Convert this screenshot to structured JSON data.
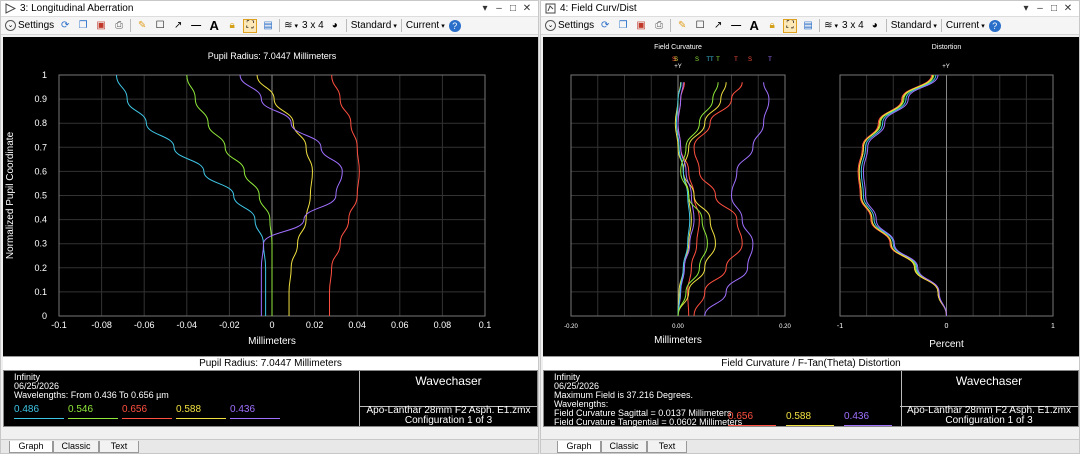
{
  "windows": {
    "left": {
      "title": "3: Longitudinal Aberration",
      "toolbar": {
        "settings": "Settings",
        "layout": "3 x 4",
        "standard": "Standard",
        "current": "Current"
      },
      "plot_title": "Pupil Radius: 7.0447 Millimeters",
      "panel_title": "Pupil Radius: 7.0447 Millimeters",
      "info": {
        "line1": "Infinity",
        "line2": "06/25/2026",
        "line3": "Wavelengths: From 0.436 To 0.656 µm",
        "brand": "Wavechaser",
        "lens": "Apo-Lanthar 28mm F2 Asph. E1.zmx",
        "config": "Configuration 1 of 3",
        "wavelengths": [
          "0.486",
          "0.546",
          "0.656",
          "0.588",
          "0.436"
        ]
      },
      "tabs": [
        "Graph",
        "Classic",
        "Text"
      ]
    },
    "right": {
      "title": "4: Field Curv/Dist",
      "toolbar": {
        "settings": "Settings",
        "layout": "3 x 4",
        "standard": "Standard",
        "current": "Current"
      },
      "panel_title": "Field Curvature / F-Tan(Theta) Distortion",
      "info": {
        "line1": "Infinity",
        "line2": "06/25/2026",
        "line3": "Maximum Field is 37.216 Degrees.",
        "line4": "Wavelengths:",
        "line5": "Field Curvature Sagittal = 0.0137 Millimeters",
        "line6": "Field Curvature Tangential = 0.0602 Millimeters",
        "brand": "Wavechaser",
        "lens": "Apo-Lanthar 28mm F2 Asph. E1.zmx",
        "config": "Configuration 1 of 3",
        "wavelengths": [
          "0.656",
          "0.588",
          "0.436"
        ]
      },
      "tabs": [
        "Graph",
        "Classic",
        "Text"
      ]
    }
  },
  "colors": {
    "w486": "#3fc6e6",
    "w546": "#8fe83a",
    "w656": "#ff5040",
    "w588": "#f0e040",
    "w436": "#a070ff"
  },
  "chart_data": [
    {
      "type": "line",
      "title": "Pupil Radius: 7.0447 Millimeters",
      "xlabel": "Millimeters",
      "ylabel": "Normalized Pupil Coordinate",
      "xlim": [
        -0.1,
        0.1
      ],
      "ylim": [
        0,
        1
      ],
      "xticks": [
        "-0.1",
        "-0.08",
        "-0.06",
        "-0.04",
        "-0.02",
        "0",
        "0.02",
        "0.04",
        "0.06",
        "0.08",
        "0.1"
      ],
      "yticks": [
        "0",
        "0.1",
        "0.2",
        "0.3",
        "0.4",
        "0.5",
        "0.6",
        "0.7",
        "0.8",
        "0.9",
        "1"
      ],
      "grid": true,
      "series": [
        {
          "name": "0.486",
          "color": "#3fc6e6",
          "x": [
            -0.003,
            -0.003,
            -0.003,
            -0.004,
            -0.008,
            -0.018,
            -0.032,
            -0.046,
            -0.059,
            -0.068,
            -0.073
          ],
          "y": [
            0,
            0.1,
            0.2,
            0.3,
            0.4,
            0.5,
            0.6,
            0.7,
            0.8,
            0.9,
            1.0
          ]
        },
        {
          "name": "0.546",
          "color": "#8fe83a",
          "x": [
            0.0,
            0.0,
            0.0,
            0.0,
            -0.001,
            -0.006,
            -0.013,
            -0.022,
            -0.03,
            -0.036,
            -0.04
          ],
          "y": [
            0,
            0.1,
            0.2,
            0.3,
            0.4,
            0.5,
            0.6,
            0.7,
            0.8,
            0.9,
            1.0
          ]
        },
        {
          "name": "0.656",
          "color": "#ff5040",
          "x": [
            0.027,
            0.027,
            0.028,
            0.032,
            0.036,
            0.04,
            0.041,
            0.04,
            0.037,
            0.032,
            0.028
          ],
          "y": [
            0,
            0.1,
            0.2,
            0.3,
            0.4,
            0.5,
            0.6,
            0.7,
            0.8,
            0.9,
            1.0
          ]
        },
        {
          "name": "0.588",
          "color": "#f0e040",
          "x": [
            0.008,
            0.008,
            0.009,
            0.012,
            0.016,
            0.018,
            0.019,
            0.016,
            0.01,
            0.001,
            -0.007
          ],
          "y": [
            0,
            0.1,
            0.2,
            0.3,
            0.4,
            0.5,
            0.6,
            0.7,
            0.8,
            0.9,
            1.0
          ]
        },
        {
          "name": "0.436",
          "color": "#a070ff",
          "x": [
            -0.005,
            -0.005,
            -0.005,
            -0.004,
            0.015,
            0.03,
            0.033,
            0.023,
            0.009,
            -0.005,
            -0.015
          ],
          "y": [
            0,
            0.1,
            0.2,
            0.3,
            0.4,
            0.5,
            0.6,
            0.7,
            0.8,
            0.9,
            1.0
          ]
        }
      ]
    },
    {
      "type": "line",
      "title": "Field Curvature",
      "xlabel": "Millimeters",
      "ylabel": "",
      "xlim": [
        -0.2,
        0.2
      ],
      "ylim": [
        0,
        1
      ],
      "xticks": [
        "-0.20",
        "0.00",
        "0.20"
      ],
      "legend_labels": [
        "S",
        "S",
        "S",
        "TT",
        "T",
        "T",
        "S",
        "T"
      ],
      "axis_label_top": "+Y",
      "grid": true,
      "series": [
        {
          "name": "0.656 S",
          "color": "#ff5040",
          "x": [
            0.02,
            0.018,
            0.025,
            0.035,
            0.04,
            0.03,
            0.02,
            0.005,
            0.0,
            0.005,
            0.012
          ],
          "y": [
            0,
            0.1,
            0.2,
            0.3,
            0.4,
            0.5,
            0.6,
            0.7,
            0.8,
            0.9,
            0.97
          ]
        },
        {
          "name": "0.656 T",
          "color": "#ff5040",
          "x": [
            0.03,
            0.05,
            0.09,
            0.12,
            0.11,
            0.07,
            0.04,
            0.03,
            0.06,
            0.1,
            0.12
          ],
          "y": [
            0,
            0.1,
            0.2,
            0.3,
            0.4,
            0.5,
            0.6,
            0.7,
            0.8,
            0.9,
            0.97
          ]
        },
        {
          "name": "0.588 S",
          "color": "#f0e040",
          "x": [
            0.0,
            0.002,
            0.01,
            0.02,
            0.025,
            0.02,
            0.01,
            0.0,
            -0.005,
            0.0,
            0.005
          ],
          "y": [
            0,
            0.1,
            0.2,
            0.3,
            0.4,
            0.5,
            0.6,
            0.7,
            0.8,
            0.9,
            0.97
          ]
        },
        {
          "name": "0.588 T",
          "color": "#f0e040",
          "x": [
            0.0,
            0.02,
            0.05,
            0.07,
            0.06,
            0.03,
            0.01,
            0.02,
            0.05,
            0.08,
            0.09
          ],
          "y": [
            0,
            0.1,
            0.2,
            0.3,
            0.4,
            0.5,
            0.6,
            0.7,
            0.8,
            0.9,
            0.97
          ]
        },
        {
          "name": "0.436 S",
          "color": "#a070ff",
          "x": [
            0.0,
            0.005,
            0.012,
            0.022,
            0.03,
            0.025,
            0.015,
            0.005,
            0.0,
            0.005,
            0.01
          ],
          "y": [
            0,
            0.1,
            0.2,
            0.3,
            0.4,
            0.5,
            0.6,
            0.7,
            0.8,
            0.9,
            0.97
          ]
        },
        {
          "name": "0.436 T",
          "color": "#a070ff",
          "x": [
            0.05,
            0.09,
            0.13,
            0.14,
            0.12,
            0.1,
            0.11,
            0.14,
            0.16,
            0.17,
            0.16
          ],
          "y": [
            0,
            0.1,
            0.2,
            0.3,
            0.4,
            0.5,
            0.6,
            0.7,
            0.8,
            0.9,
            0.97
          ]
        },
        {
          "name": "0.486 S",
          "color": "#3fc6e6",
          "x": [
            0.0,
            0.004,
            0.01,
            0.018,
            0.022,
            0.018,
            0.01,
            0.002,
            -0.003,
            0.0,
            0.006
          ],
          "y": [
            0,
            0.1,
            0.2,
            0.3,
            0.4,
            0.5,
            0.6,
            0.7,
            0.8,
            0.9,
            0.97
          ]
        },
        {
          "name": "0.546 T",
          "color": "#8fe83a",
          "x": [
            0.0,
            0.015,
            0.04,
            0.055,
            0.045,
            0.02,
            0.005,
            0.015,
            0.04,
            0.065,
            0.075
          ],
          "y": [
            0,
            0.1,
            0.2,
            0.3,
            0.4,
            0.5,
            0.6,
            0.7,
            0.8,
            0.9,
            0.97
          ]
        }
      ]
    },
    {
      "type": "line",
      "title": "Distortion",
      "xlabel": "Percent",
      "ylabel": "",
      "xlim": [
        -1,
        1
      ],
      "ylim": [
        0,
        1
      ],
      "xticks": [
        "-1",
        "0",
        "1"
      ],
      "axis_label_top": "+Y",
      "grid": true,
      "series": [
        {
          "name": "0.486",
          "color": "#3fc6e6",
          "x": [
            0,
            -0.08,
            -0.28,
            -0.5,
            -0.68,
            -0.78,
            -0.8,
            -0.76,
            -0.6,
            -0.38,
            -0.1
          ],
          "y": [
            0,
            0.1,
            0.2,
            0.3,
            0.4,
            0.5,
            0.6,
            0.7,
            0.8,
            0.9,
            1.0
          ]
        },
        {
          "name": "0.546",
          "color": "#8fe83a",
          "x": [
            0,
            -0.08,
            -0.29,
            -0.52,
            -0.7,
            -0.8,
            -0.82,
            -0.78,
            -0.62,
            -0.4,
            -0.12
          ],
          "y": [
            0,
            0.1,
            0.2,
            0.3,
            0.4,
            0.5,
            0.6,
            0.7,
            0.8,
            0.9,
            1.0
          ]
        },
        {
          "name": "0.656",
          "color": "#ff5040",
          "x": [
            0,
            -0.08,
            -0.3,
            -0.53,
            -0.71,
            -0.81,
            -0.83,
            -0.79,
            -0.64,
            -0.42,
            -0.14
          ],
          "y": [
            0,
            0.1,
            0.2,
            0.3,
            0.4,
            0.5,
            0.6,
            0.7,
            0.8,
            0.9,
            1.0
          ]
        },
        {
          "name": "0.588",
          "color": "#f0e040",
          "x": [
            0,
            -0.08,
            -0.3,
            -0.52,
            -0.7,
            -0.8,
            -0.82,
            -0.78,
            -0.63,
            -0.41,
            -0.13
          ],
          "y": [
            0,
            0.1,
            0.2,
            0.3,
            0.4,
            0.5,
            0.6,
            0.7,
            0.8,
            0.9,
            1.0
          ]
        },
        {
          "name": "0.436",
          "color": "#a070ff",
          "x": [
            0,
            -0.07,
            -0.27,
            -0.49,
            -0.66,
            -0.76,
            -0.78,
            -0.74,
            -0.58,
            -0.36,
            -0.08
          ],
          "y": [
            0,
            0.1,
            0.2,
            0.3,
            0.4,
            0.5,
            0.6,
            0.7,
            0.8,
            0.9,
            1.0
          ]
        }
      ]
    }
  ]
}
